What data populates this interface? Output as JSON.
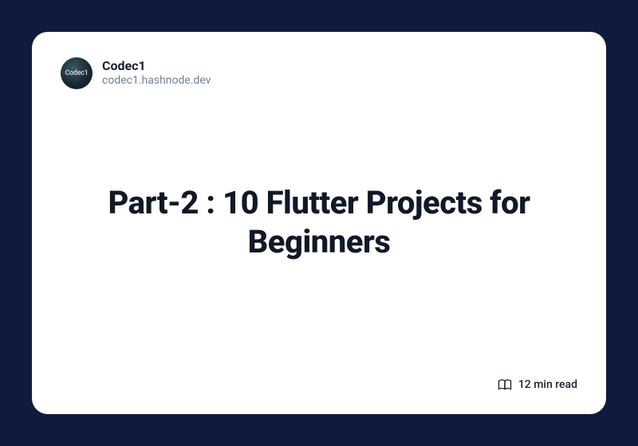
{
  "author": {
    "name": "Codec1",
    "domain": "codec1.hashnode.dev",
    "avatar_label": "Codec1"
  },
  "title": "Part-2 : 10 Flutter Projects for Beginners",
  "read_time": "12 min read",
  "colors": {
    "background": "#0f1b3d",
    "card": "#ffffff",
    "text_primary": "#111827",
    "text_muted": "#718096"
  }
}
